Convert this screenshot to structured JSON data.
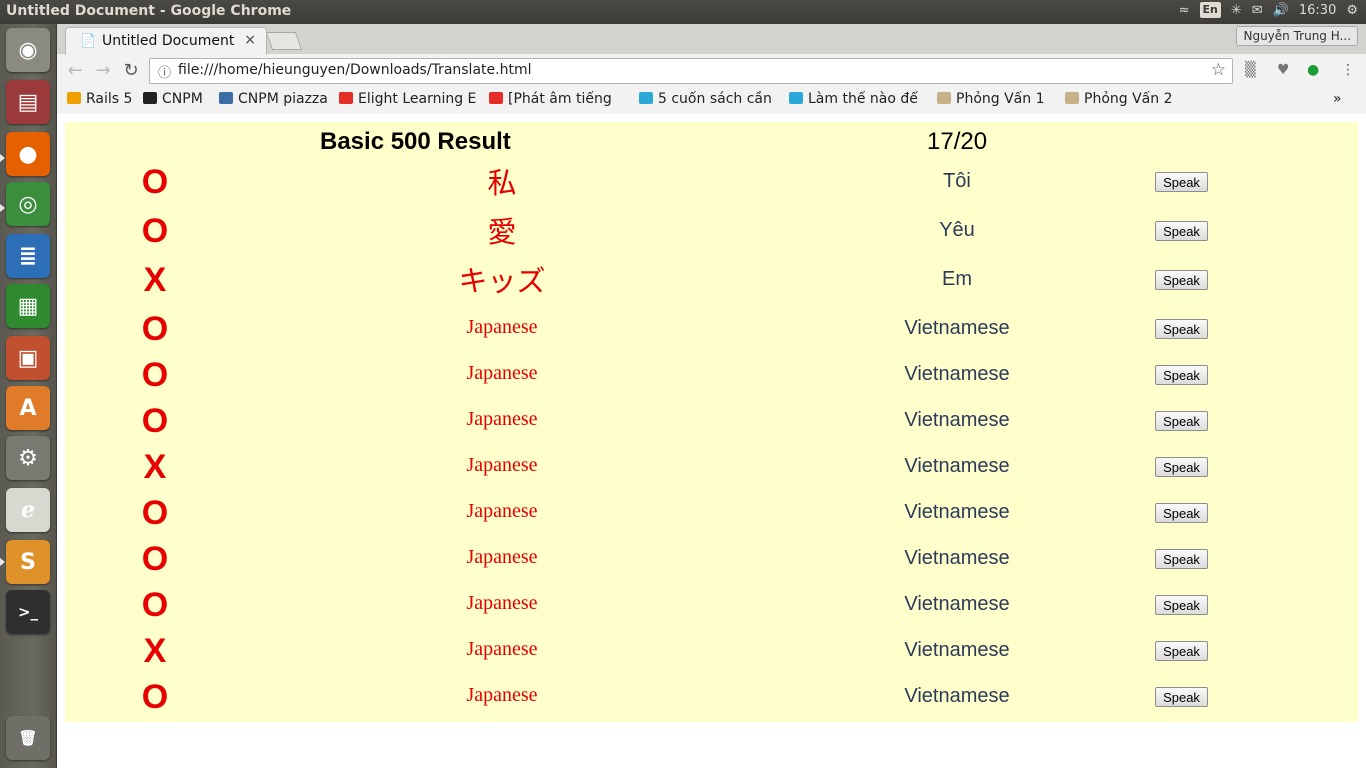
{
  "os_panel": {
    "window_title": "Untitled Document - Google Chrome",
    "keyboard_layout": "En",
    "clock": "16:30"
  },
  "browser": {
    "tab": {
      "title": "Untitled Document",
      "close": "×"
    },
    "profile_name": "Nguyễn Trung H...",
    "url": "file:///home/hieunguyen/Downloads/Translate.html",
    "bookmarks": [
      {
        "label": "Rails 5",
        "icon": "rails-icon",
        "color": "#f0a000"
      },
      {
        "label": "CNPM",
        "icon": "github-icon",
        "color": "#222222"
      },
      {
        "label": "CNPM piazza",
        "icon": "piazza-icon",
        "color": "#3a6ea5"
      },
      {
        "label": "Elight Learning E",
        "icon": "youtube-icon",
        "color": "#e52d27"
      },
      {
        "label": "[Phát âm tiếng",
        "icon": "youtube-icon",
        "color": "#e52d27"
      },
      {
        "label": "5 cuốn sách cần",
        "icon": "bookmark-icon",
        "color": "#2aa9d8"
      },
      {
        "label": "Làm thế nào để",
        "icon": "bookmark-icon",
        "color": "#2aa9d8"
      },
      {
        "label": "Phỏng Vấn 1",
        "icon": "avatar-icon",
        "color": "#c9b18a"
      },
      {
        "label": "Phỏng Vấn 2",
        "icon": "avatar-icon",
        "color": "#c9b18a"
      }
    ],
    "bookmarks_overflow": "»"
  },
  "result": {
    "title": "Basic 500 Result",
    "score": "17/20",
    "speak_label": "Speak",
    "rows": [
      {
        "mark": "O",
        "japanese": "私",
        "vietnamese": "Tôi"
      },
      {
        "mark": "O",
        "japanese": "愛",
        "vietnamese": "Yêu"
      },
      {
        "mark": "X",
        "japanese": "キッズ",
        "vietnamese": "Em"
      },
      {
        "mark": "O",
        "japanese": "Japanese",
        "vietnamese": "Vietnamese"
      },
      {
        "mark": "O",
        "japanese": "Japanese",
        "vietnamese": "Vietnamese"
      },
      {
        "mark": "O",
        "japanese": "Japanese",
        "vietnamese": "Vietnamese"
      },
      {
        "mark": "X",
        "japanese": "Japanese",
        "vietnamese": "Vietnamese"
      },
      {
        "mark": "O",
        "japanese": "Japanese",
        "vietnamese": "Vietnamese"
      },
      {
        "mark": "O",
        "japanese": "Japanese",
        "vietnamese": "Vietnamese"
      },
      {
        "mark": "O",
        "japanese": "Japanese",
        "vietnamese": "Vietnamese"
      },
      {
        "mark": "X",
        "japanese": "Japanese",
        "vietnamese": "Vietnamese"
      },
      {
        "mark": "O",
        "japanese": "Japanese",
        "vietnamese": "Vietnamese"
      }
    ]
  },
  "launcher": [
    {
      "name": "ubuntu-dash-icon",
      "color": "#8a8a80"
    },
    {
      "name": "files-icon",
      "color": "#9b3a3a"
    },
    {
      "name": "firefox-icon",
      "color": "#e66000"
    },
    {
      "name": "chrome-icon",
      "color": "#3b8e3b"
    },
    {
      "name": "writer-icon",
      "color": "#2c6fb7"
    },
    {
      "name": "calc-icon",
      "color": "#2f8a2f"
    },
    {
      "name": "impress-icon",
      "color": "#c0502f"
    },
    {
      "name": "software-center-icon",
      "color": "#e07b2a"
    },
    {
      "name": "system-settings-icon",
      "color": "#7a7a72"
    },
    {
      "name": "document-viewer-icon",
      "color": "#d8d8d0"
    },
    {
      "name": "sublime-text-icon",
      "color": "#e0922a"
    },
    {
      "name": "terminal-icon",
      "color": "#2f2f2f"
    },
    {
      "name": "trash-icon",
      "color": "#6f6f68"
    }
  ]
}
